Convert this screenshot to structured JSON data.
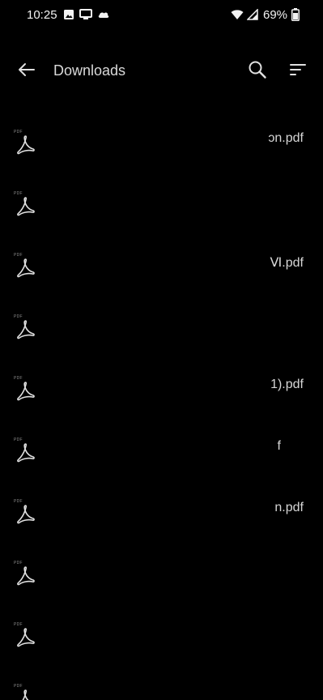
{
  "status_bar": {
    "time": "10:25",
    "battery": "69%",
    "icons": [
      "image-icon",
      "cast-icon",
      "cloud-icon",
      "wifi-icon",
      "signal-icon",
      "battery-icon"
    ]
  },
  "toolbar": {
    "title": "Downloads",
    "back_icon": "arrow-left-icon",
    "search_icon": "search-icon",
    "sort_icon": "sort-icon"
  },
  "files": [
    {
      "name_visible": "ɔn.pdf",
      "tag": "PDF"
    },
    {
      "name_visible": "",
      "tag": "PDF"
    },
    {
      "name_visible": "Ⅵ.pdf",
      "tag": "PDF"
    },
    {
      "name_visible": "",
      "tag": "PDF"
    },
    {
      "name_visible": "1).pdf",
      "tag": "PDF"
    },
    {
      "name_visible": "f",
      "tag": "PDF"
    },
    {
      "name_visible": "n.pdf",
      "tag": "PDF"
    },
    {
      "name_visible": "",
      "tag": "PDF"
    },
    {
      "name_visible": "",
      "tag": "PDF"
    },
    {
      "name_visible": "",
      "tag": "PDF"
    }
  ],
  "colors": {
    "background": "#000000",
    "text": "#d6d6d6",
    "icon": "#e0e0e0"
  }
}
